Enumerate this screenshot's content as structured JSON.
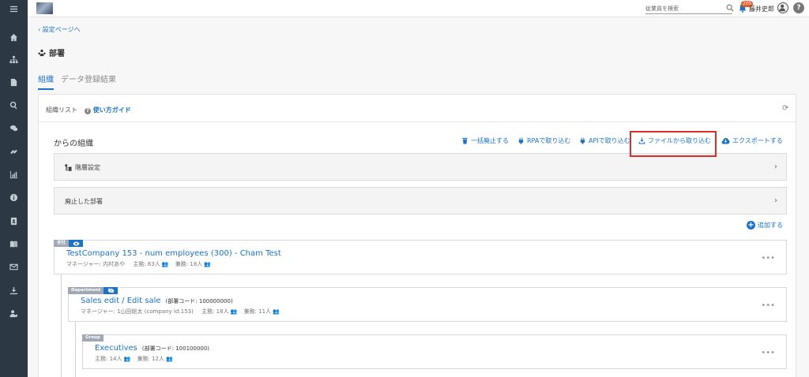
{
  "topbar": {
    "search_placeholder": "従業員を検索",
    "notification_count": "205",
    "user_name": "藤井史郎",
    "help_label": "?"
  },
  "nav": {
    "back_label": "設定ページへ",
    "page_title": "部署"
  },
  "tabs": [
    {
      "label": "組織",
      "active": true
    },
    {
      "label": "データ登録結果",
      "active": false
    }
  ],
  "panel": {
    "title": "組織リスト",
    "guide_label": "使い方ガイド"
  },
  "org": {
    "title": "からの組織",
    "actions": {
      "bulk_abolish": "一括廃止する",
      "rpa_import": "RPAで取り込む",
      "api_import": "APIで取り込む",
      "file_import": "ファイルから取り込む",
      "export": "エクスポートする"
    },
    "hierarchy_label": "階層設定",
    "abolished_label": "廃止した部署",
    "add_label": "追加する"
  },
  "units": [
    {
      "tag": "全社",
      "name": "TestCompany 153 - num employees (300) - Cham Test",
      "code": "",
      "manager": "マネージャー: 内村あや",
      "main_count": "主務: 63人",
      "concurrent_count": "兼務: 18人"
    },
    {
      "tag": "Department",
      "name": "Sales edit / Edit sale",
      "code": "(部署コード: 100000000)",
      "manager": "マネージャー: 1山田総太 (company id:153)",
      "main_count": "主務: 18人",
      "concurrent_count": "兼務: 11人"
    },
    {
      "tag": "Group",
      "name": "Executives",
      "code": "(部署コード: 100100000)",
      "manager": "",
      "main_count": "主務: 14人",
      "concurrent_count": "兼務: 12人"
    }
  ],
  "colors": {
    "accent": "#1a73c8",
    "sidebar": "#2d3845",
    "highlight_border": "#e02b2b",
    "badge": "#e25b2a"
  }
}
